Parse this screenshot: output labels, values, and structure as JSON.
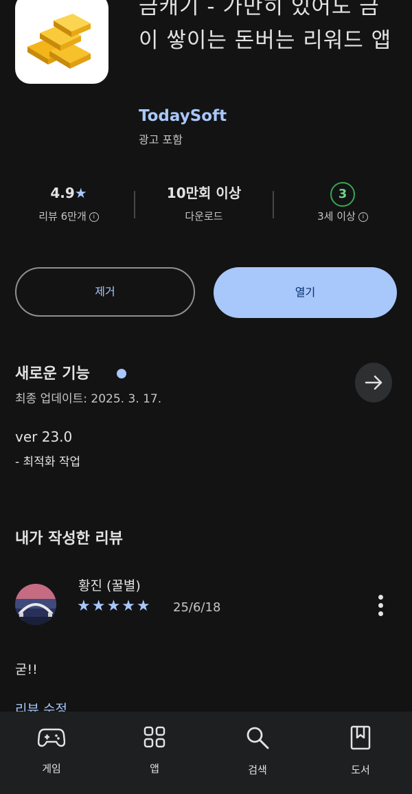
{
  "app": {
    "title": "금캐기 - 가만히 있어도 금이 쌓이는 돈버는 리워드 앱",
    "developer": "TodaySoft",
    "ad_label": "광고 포함",
    "icon": "gold-bars-icon"
  },
  "stats": {
    "rating": {
      "value": "4.9",
      "label": "리뷰 6만개"
    },
    "downloads": {
      "value": "10만회 이상",
      "label": "다운로드"
    },
    "age": {
      "badge": "3",
      "label": "3세 이상"
    }
  },
  "buttons": {
    "remove": "제거",
    "open": "열기"
  },
  "whats_new": {
    "title": "새로운 기능",
    "updated": "최종 업데이트: 2025. 3. 17.",
    "version": "ver 23.0",
    "note": "- 최적화 작업"
  },
  "my_review": {
    "title": "내가 작성한 리뷰",
    "reviewer": "황진 (꿀별)",
    "stars": "★★★★★",
    "rating": 5,
    "date": "25/6/18",
    "text": "굳!!",
    "edit_link": "리뷰 수정"
  },
  "bottom_nav": [
    {
      "label": "게임",
      "icon": "gamepad-icon"
    },
    {
      "label": "앱",
      "icon": "apps-grid-icon"
    },
    {
      "label": "검색",
      "icon": "search-icon"
    },
    {
      "label": "도서",
      "icon": "bookmark-icon"
    }
  ],
  "colors": {
    "accent": "#a8c7fa",
    "background": "#131314",
    "age_badge": "#34a853"
  }
}
